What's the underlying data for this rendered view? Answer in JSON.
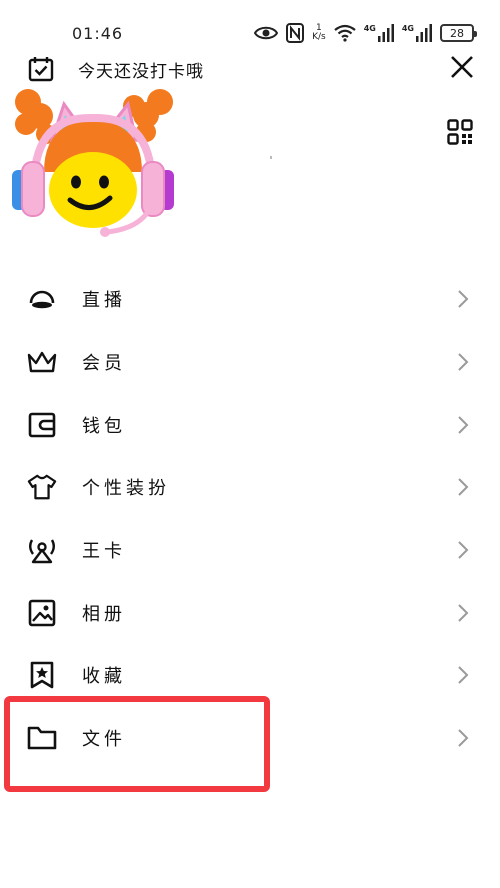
{
  "status_bar": {
    "time": "01:46",
    "net_speed_value": "1",
    "net_speed_unit": "K/s",
    "signal_1_label": "4G",
    "signal_2_label": "4G",
    "battery": "28"
  },
  "header": {
    "checkin_label": "今天还没打卡哦"
  },
  "menu": {
    "items": [
      {
        "label": "直播",
        "icon": "live-icon"
      },
      {
        "label": "会员",
        "icon": "crown-icon"
      },
      {
        "label": "钱包",
        "icon": "wallet-icon"
      },
      {
        "label": "个性装扮",
        "icon": "shirt-icon"
      },
      {
        "label": "王卡",
        "icon": "broadcast-icon"
      },
      {
        "label": "相册",
        "icon": "photo-album-icon"
      },
      {
        "label": "收藏",
        "icon": "bookmark-icon"
      },
      {
        "label": "文件",
        "icon": "folder-icon"
      }
    ]
  },
  "colors": {
    "highlight": "#f2393f",
    "icon": "#111111",
    "chevron": "#9a9a9a"
  }
}
